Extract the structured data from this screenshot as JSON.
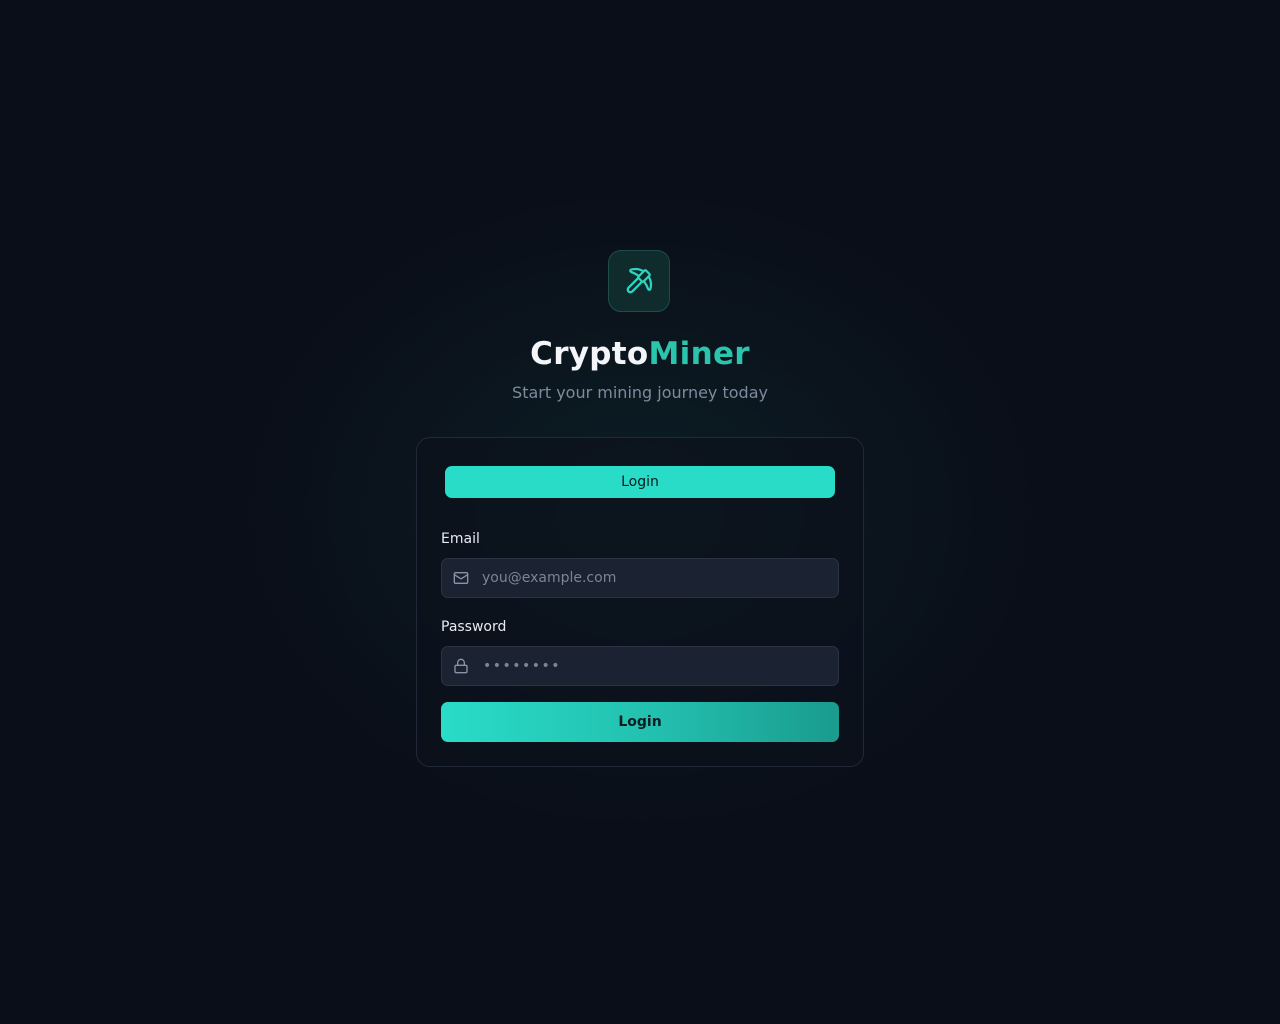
{
  "brand": {
    "icon": "pickaxe-icon",
    "title_part1": "Crypto",
    "title_part2": "Miner",
    "subtitle": "Start your mining journey today",
    "accent_color": "#2bc4ad"
  },
  "tabs": [
    {
      "label": "Login",
      "active": true
    }
  ],
  "form": {
    "email": {
      "label": "Email",
      "placeholder": "you@example.com",
      "value": "",
      "icon": "mail-icon"
    },
    "password": {
      "label": "Password",
      "masked_placeholder": "••••••••",
      "value": "",
      "icon": "lock-icon"
    },
    "submit_label": "Login"
  }
}
